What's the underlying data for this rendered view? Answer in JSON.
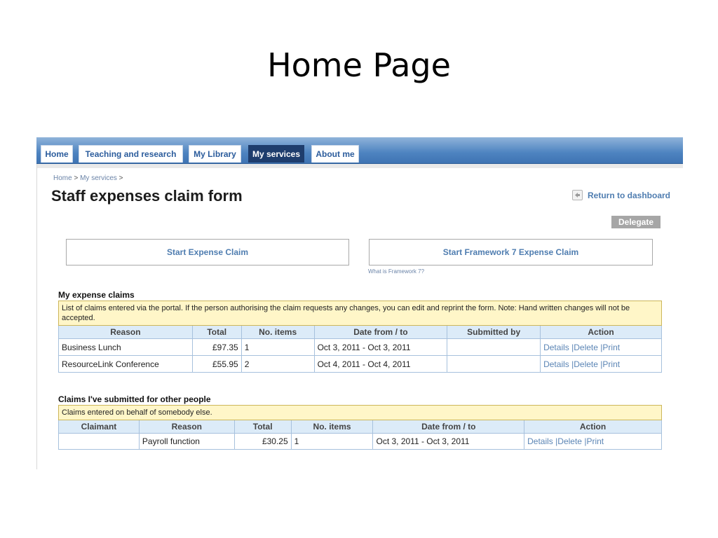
{
  "slide": {
    "title": "Home Page"
  },
  "nav": {
    "tabs": [
      {
        "label": "Home",
        "active": false
      },
      {
        "label": "Teaching and research",
        "active": false
      },
      {
        "label": "My Library",
        "active": false
      },
      {
        "label": "My services",
        "active": true
      },
      {
        "label": "About me",
        "active": false
      }
    ]
  },
  "breadcrumb": {
    "home": "Home",
    "sep1": ">",
    "services": "My services",
    "sep2": ">"
  },
  "page": {
    "title": "Staff expenses claim form"
  },
  "actions": {
    "return_label": "Return to dashboard",
    "delegate_label": "Delegate",
    "start_expense": "Start Expense Claim",
    "start_framework": "Start Framework 7 Expense Claim",
    "framework_help": "What is Framework 7?"
  },
  "my_claims": {
    "heading": "My expense claims",
    "note": "List of claims entered via the portal. If the person authorising the claim requests any changes, you can edit and reprint the form. Note: Hand written changes will not be accepted.",
    "columns": [
      "Reason",
      "Total",
      "No. items",
      "Date from / to",
      "Submitted by",
      "Action"
    ],
    "rows": [
      {
        "reason": "Business Lunch",
        "total": "£97.35",
        "items": "1",
        "dates": "Oct 3, 2011 - Oct 3, 2011",
        "submitted_by": ""
      },
      {
        "reason": "ResourceLink Conference",
        "total": "£55.95",
        "items": "2",
        "dates": "Oct 4, 2011 - Oct 4, 2011",
        "submitted_by": ""
      }
    ]
  },
  "other_claims": {
    "heading": "Claims I've submitted for other people",
    "note": "Claims entered on behalf of somebody else.",
    "columns": [
      "Claimant",
      "Reason",
      "Total",
      "No. items",
      "Date from / to",
      "Action"
    ],
    "rows": [
      {
        "claimant": "",
        "reason": "Payroll function",
        "total": "£30.25",
        "items": "1",
        "dates": "Oct 3, 2011 - Oct 3, 2011"
      }
    ]
  },
  "row_actions": {
    "details": "Details",
    "delete": "Delete",
    "print": "Print",
    "sep": "|"
  },
  "icons": {
    "return": "arrow-left-icon"
  },
  "colors": {
    "nav_blue": "#4d83c0",
    "active_tab": "#1e3d6d",
    "link": "#4f7db0",
    "note_bg": "#fff6c8",
    "header_bg": "#dcebf8"
  }
}
